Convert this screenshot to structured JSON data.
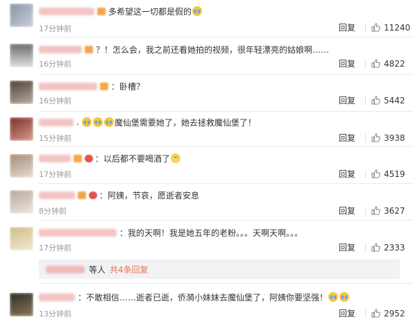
{
  "comments": [
    {
      "text": "多希望这一切都是假的",
      "time": "17分钟前",
      "reply": "回复",
      "likes": "11240"
    },
    {
      "text": "？！怎么会，我之前还看她拍的视频，很年轻漂亮的姑娘啊……",
      "time": "16分钟前",
      "reply": "回复",
      "likes": "4822"
    },
    {
      "text": "：卧槽？",
      "time": "16分钟前",
      "reply": "回复",
      "likes": "5442"
    },
    {
      "text": "魔仙堡需要她了，她去拯救魔仙堡了！",
      "time": "15分钟前",
      "reply": "回复",
      "likes": "3938"
    },
    {
      "text": "：以后都不要喝酒了",
      "time": "17分钟前",
      "reply": "回复",
      "likes": "4519"
    },
    {
      "text": "：阿姨，节哀，愿逝者安息",
      "time": "8分钟前",
      "reply": "回复",
      "likes": "3627"
    },
    {
      "text": "：我的天啊！我是她五年的老粉。。。天啊天啊。。。",
      "time": "17分钟前",
      "reply": "回复",
      "likes": "2333",
      "sub": {
        "wait": "等人",
        "more": "共4条回复"
      }
    },
    {
      "text": "：不敢相信……逝者已逝，侨漪小妹妹去魔仙堡了，阿姨你要坚强！",
      "time": "13分钟前",
      "reply": "回复",
      "likes": "2952"
    }
  ]
}
